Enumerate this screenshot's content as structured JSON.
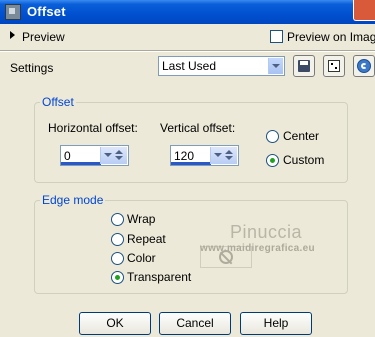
{
  "window": {
    "title": "Offset"
  },
  "preview": {
    "label": "Preview",
    "preview_on_image_label": "Preview on Image"
  },
  "settings": {
    "label": "Settings",
    "selected": "Last Used"
  },
  "offset": {
    "title": "Offset",
    "horizontal_label": "Horizontal offset:",
    "horizontal_value": "0",
    "vertical_label": "Vertical offset:",
    "vertical_value": "120",
    "center_label": "Center",
    "custom_label": "Custom",
    "selected": "Custom"
  },
  "edge_mode": {
    "title": "Edge mode",
    "options": [
      "Wrap",
      "Repeat",
      "Color",
      "Transparent"
    ],
    "selected": "Transparent"
  },
  "watermark": {
    "name": "Pinuccia",
    "site": "www.maidiregrafica.eu"
  },
  "buttons": {
    "ok": "OK",
    "cancel": "Cancel",
    "help": "Help"
  },
  "colors": {
    "titlebar": "#0054e3",
    "group_title": "#0046d5",
    "background": "#ece9d8"
  }
}
